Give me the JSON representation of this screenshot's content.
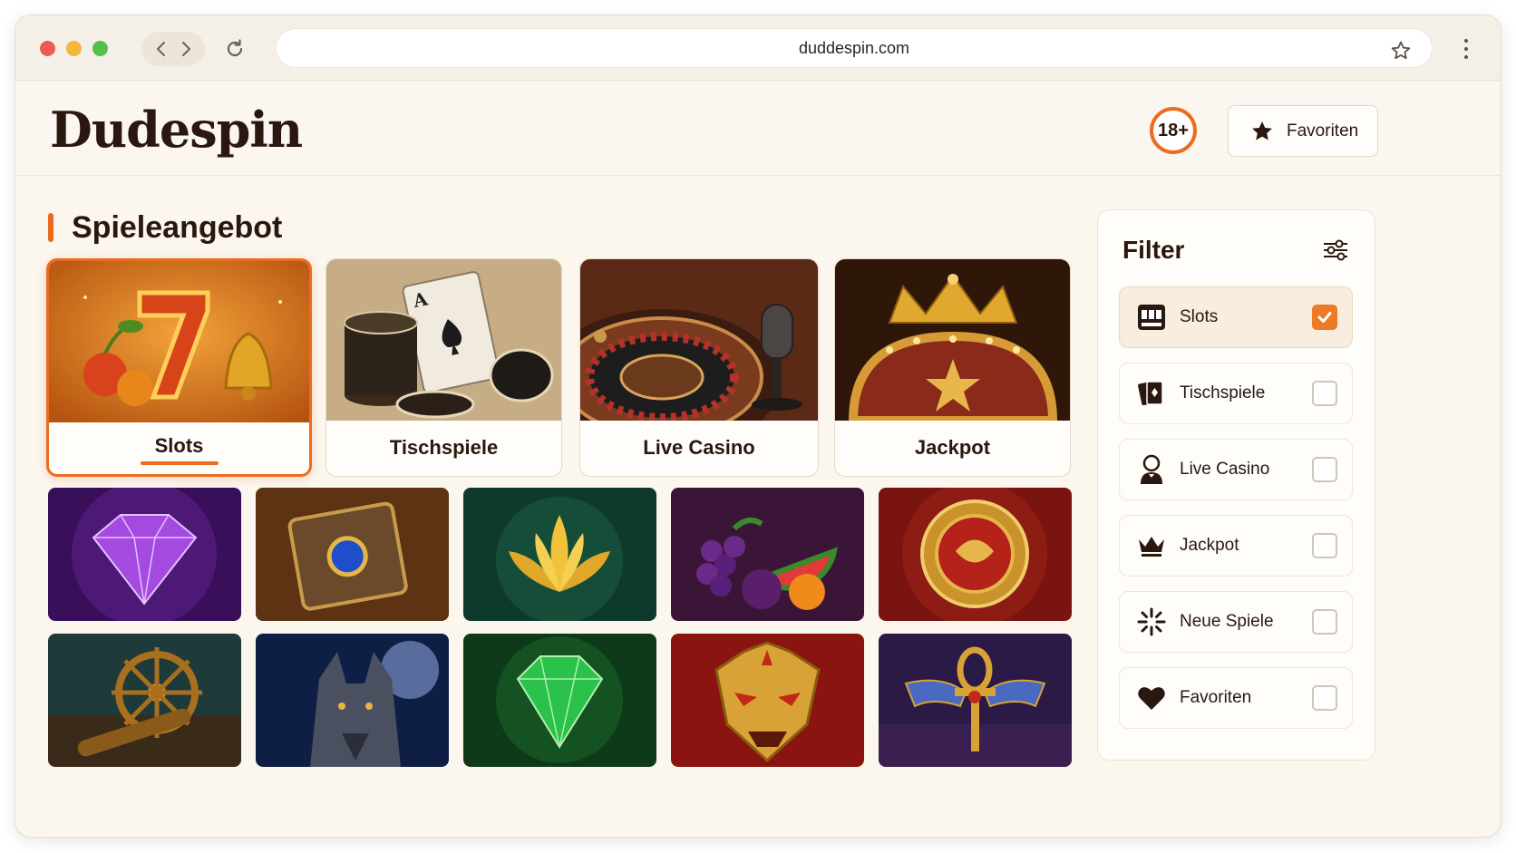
{
  "browser": {
    "url": "duddespin.com",
    "icons": [
      "back-icon",
      "forward-icon",
      "reload-icon",
      "bookmark-star-icon",
      "more-menu-icon"
    ]
  },
  "header": {
    "logo": "Dudespin",
    "age_badge": "18+",
    "favorites_button": "Favoriten"
  },
  "section": {
    "title": "Spieleangebot"
  },
  "categories": [
    {
      "label": "Slots",
      "active": true
    },
    {
      "label": "Tischspiele",
      "active": false
    },
    {
      "label": "Live Casino",
      "active": false
    },
    {
      "label": "Jackpot",
      "active": false
    }
  ],
  "games": [
    {
      "art": "purple-diamond"
    },
    {
      "art": "jeweled-book"
    },
    {
      "art": "golden-lotus"
    },
    {
      "art": "fruits"
    },
    {
      "art": "dragon-coin"
    },
    {
      "art": "ship-wheel-spyglass"
    },
    {
      "art": "wolf-moon"
    },
    {
      "art": "green-emerald"
    },
    {
      "art": "golden-mask"
    },
    {
      "art": "winged-ankh"
    }
  ],
  "filter": {
    "title": "Filter",
    "items": [
      {
        "label": "Slots",
        "icon": "slot-machine-icon",
        "checked": true
      },
      {
        "label": "Tischspiele",
        "icon": "playing-card-icon",
        "checked": false
      },
      {
        "label": "Live Casino",
        "icon": "dealer-icon",
        "checked": false
      },
      {
        "label": "Jackpot",
        "icon": "crown-icon",
        "checked": false
      },
      {
        "label": "Neue Spiele",
        "icon": "sparkle-icon",
        "checked": false
      },
      {
        "label": "Favoriten",
        "icon": "heart-icon",
        "checked": false
      }
    ]
  },
  "colors": {
    "accent": "#ec6b1f",
    "text": "#2a1810",
    "background": "#fbf6ee"
  }
}
